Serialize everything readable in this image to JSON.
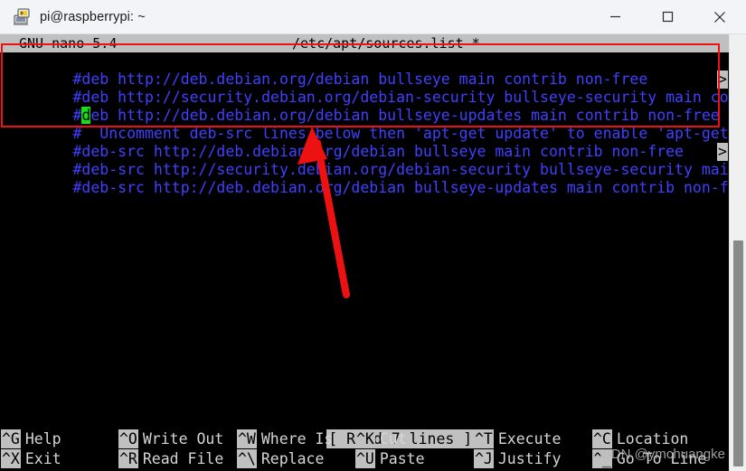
{
  "window": {
    "title": "pi@raspberrypi: ~",
    "icon": "putty-terminal-icon",
    "minimize_label": "—",
    "maximize_label": "☐",
    "close_label": "✕"
  },
  "nano": {
    "version_label": "GNU nano 5.4",
    "filename": "/etc/apt/sources.list *",
    "status_message": "[ Read 7 lines ]",
    "continuation_marker": ">",
    "cursor_char": "d",
    "lines": [
      {
        "pre": "#deb http://deb.debian.org/debian bullseye main contrib non-free",
        "overflow": false
      },
      {
        "pre": "#deb http://security.debian.org/debian-security bullseye-security main contrib",
        "overflow": true
      },
      {
        "pre_a": "#",
        "cursor": "d",
        "pre_b": "eb http://deb.debian.org/debian bullseye-updates main contrib non-free",
        "overflow": false
      },
      {
        "pre": "#  Uncomment deb-src lines below then 'apt-get update' to enable 'apt-get source'",
        "overflow": false
      },
      {
        "pre": "#deb-src http://deb.debian.org/debian bullseye main contrib non-free",
        "overflow": false
      },
      {
        "pre": "#deb-src http://security.debian.org/debian-security bullseye-security main cont",
        "overflow": true
      },
      {
        "pre": "#deb-src http://deb.debian.org/debian bullseye-updates main contrib non-free",
        "overflow": false
      }
    ]
  },
  "shortcuts": {
    "row1": [
      {
        "key": "^G",
        "label": "Help"
      },
      {
        "key": "^O",
        "label": "Write Out"
      },
      {
        "key": "^W",
        "label": "Where Is"
      },
      {
        "key": "^K",
        "label": "Cut"
      },
      {
        "key": "^T",
        "label": "Execute"
      },
      {
        "key": "^C",
        "label": "Location"
      }
    ],
    "row2": [
      {
        "key": "^X",
        "label": "Exit"
      },
      {
        "key": "^R",
        "label": "Read File"
      },
      {
        "key": "^\\",
        "label": "Replace"
      },
      {
        "key": "^U",
        "label": "Paste"
      },
      {
        "key": "^J",
        "label": "Justify"
      },
      {
        "key": "^_",
        "label": "Go To Line"
      }
    ]
  },
  "annotations": {
    "highlight_color": "#ee1111",
    "watermark": "CSDN @ymchuangke"
  },
  "colors": {
    "terminal_bg": "#000000",
    "comment_text": "#4040ff",
    "cursor_bg": "#16e016",
    "nano_bar_bg": "#c0c0c0",
    "titlebar_bg": "#f3f4f7"
  }
}
